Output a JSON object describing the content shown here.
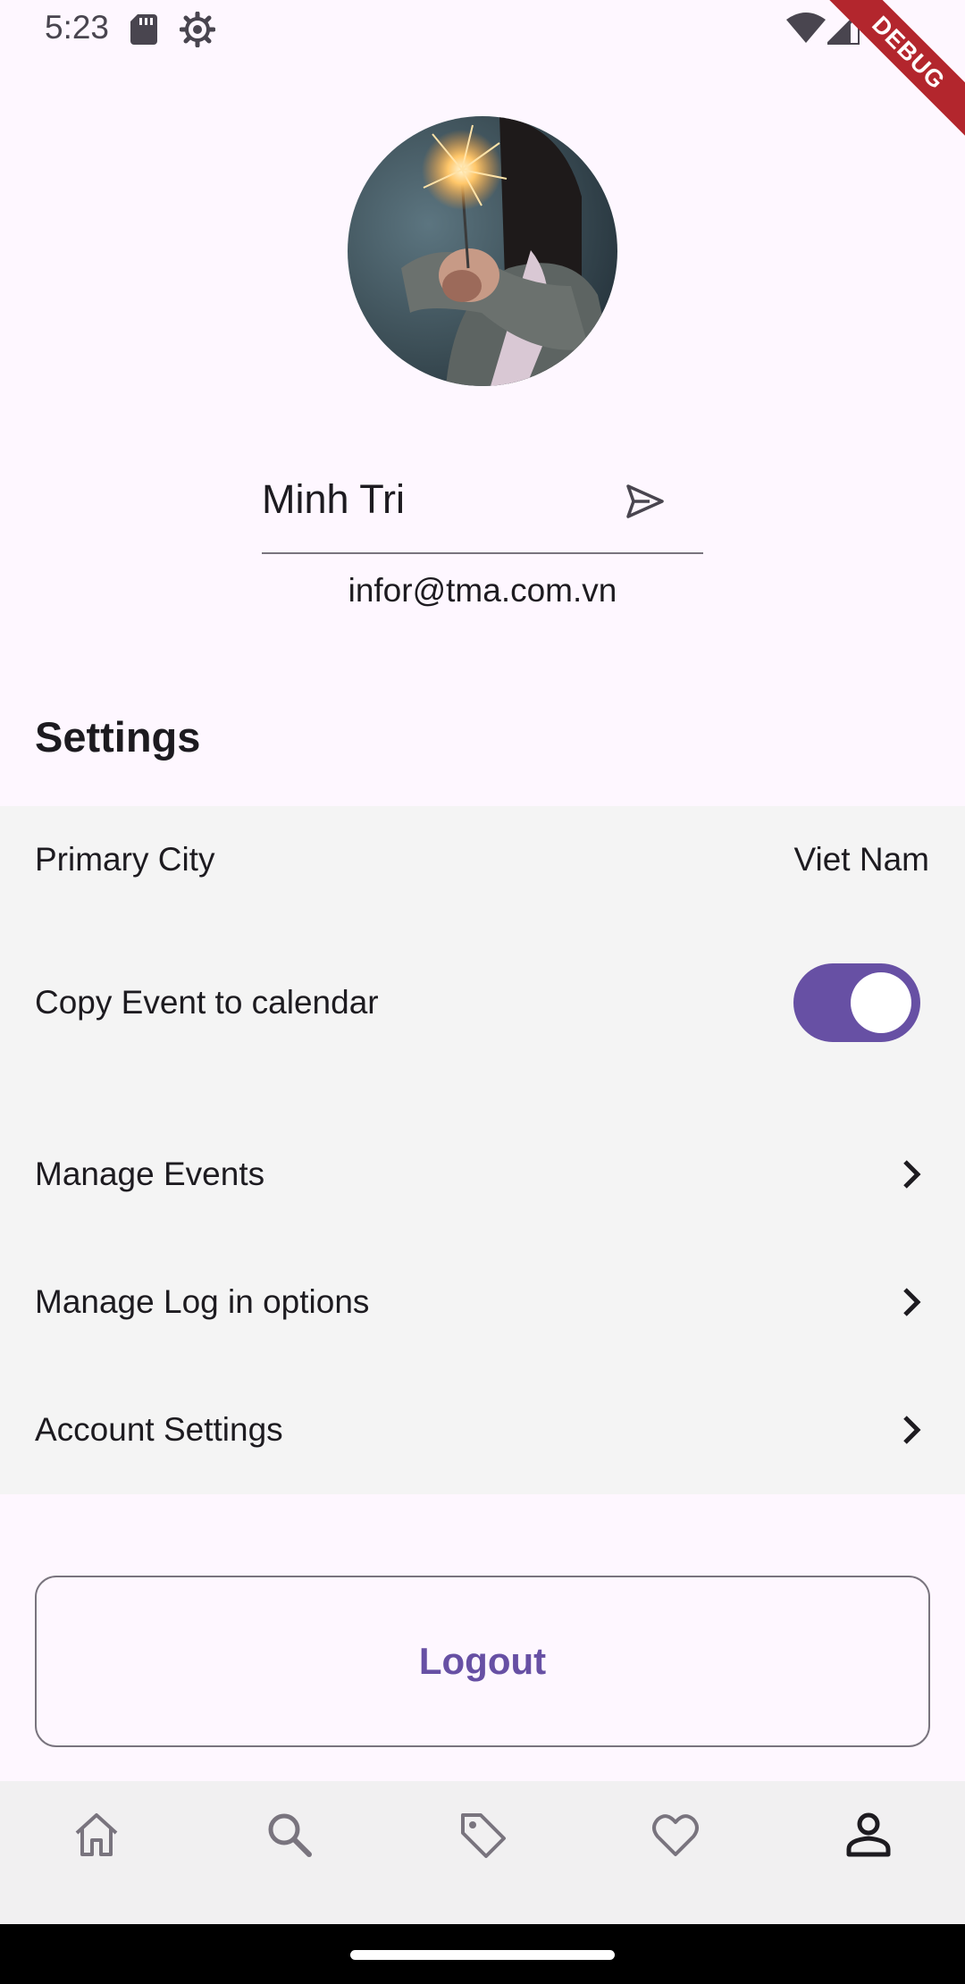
{
  "status_bar": {
    "time": "5:23",
    "debug_label": "DEBUG"
  },
  "profile": {
    "name": "Minh Tri",
    "email": "infor@tma.com.vn",
    "avatar_icon": "sparkler-photo"
  },
  "settings": {
    "heading": "Settings",
    "primary_city": {
      "label": "Primary City",
      "value": "Viet Nam"
    },
    "copy_event": {
      "label": "Copy Event to calendar",
      "enabled": true
    },
    "manage_events": {
      "label": "Manage Events"
    },
    "manage_login": {
      "label": "Manage Log in options"
    },
    "account_settings": {
      "label": "Account Settings"
    }
  },
  "logout": {
    "label": "Logout"
  },
  "bottom_nav": {
    "items": [
      {
        "icon": "home-icon",
        "active": false
      },
      {
        "icon": "search-icon",
        "active": false
      },
      {
        "icon": "tag-icon",
        "active": false
      },
      {
        "icon": "heart-icon",
        "active": false
      },
      {
        "icon": "person-icon",
        "active": true
      }
    ]
  },
  "colors": {
    "accent": "#6750a4",
    "background": "#fef7ff",
    "panel": "#f4f4f4"
  }
}
